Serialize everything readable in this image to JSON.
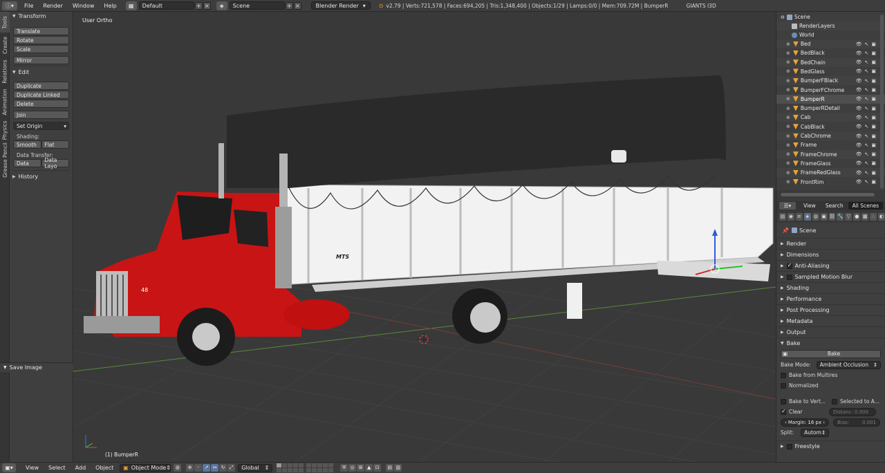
{
  "topbar": {
    "menus": [
      "File",
      "Render",
      "Window",
      "Help"
    ],
    "layout": "Default",
    "scene": "Scene",
    "engine": "Blender Render",
    "stats": "v2.79 | Verts:721,578 | Faces:694,205 | Tris:1,348,400 | Objects:1/29 | Lamps:0/0 | Mem:709.72M | BumperR",
    "extra": "GIANTS I3D"
  },
  "vtabs": [
    "Tools",
    "Create",
    "Relations",
    "Animation",
    "Physics",
    "Grease Pencil"
  ],
  "toolshelf": {
    "transform": {
      "title": "Transform",
      "buttons": [
        "Translate",
        "Rotate",
        "Scale",
        "Mirror"
      ]
    },
    "edit": {
      "title": "Edit",
      "buttons": [
        "Duplicate",
        "Duplicate Linked",
        "Delete",
        "Join"
      ],
      "set_origin": "Set Origin",
      "shading_label": "Shading:",
      "smooth": "Smooth",
      "flat": "Flat",
      "transfer_label": "Data Transfer:",
      "data": "Data",
      "data_layout": "Data Layo"
    },
    "history": "History",
    "save_image": "Save Image"
  },
  "viewport": {
    "view_label": "User Ortho",
    "object_label": "(1) BumperR",
    "truck_text": {
      "number": "48",
      "brand": "MTS"
    }
  },
  "outliner": {
    "scene": "Scene",
    "render_layers": "RenderLayers",
    "world": "World",
    "objects": [
      "Bed",
      "BedBlack",
      "BedChain",
      "BedGlass",
      "BumperFBlack",
      "BumperFChrome",
      "BumperR",
      "BumperRDetail",
      "Cab",
      "CabBlack",
      "CabChrome",
      "Frame",
      "FrameChrome",
      "FrameGlass",
      "FrameRedGlass",
      "FrontRim"
    ],
    "selected": "BumperR"
  },
  "outliner_header": {
    "view": "View",
    "search": "Search",
    "filter": "All Scenes"
  },
  "properties": {
    "context": "Scene",
    "sections": [
      "Render",
      "Dimensions",
      "Anti-Aliasing",
      "Sampled Motion Blur",
      "Shading",
      "Performance",
      "Post Processing",
      "Metadata",
      "Output",
      "Bake"
    ],
    "bake": {
      "button": "Bake",
      "mode_label": "Bake Mode:",
      "mode_value": "Ambient Occlusion",
      "from_multires": "Bake from Multires",
      "normalized": "Normalized",
      "to_vertex": "Bake to Vert...",
      "selected_to_active": "Selected to A...",
      "clear": "Clear",
      "distance": "Distanc: 0.000",
      "margin": "Margin: 16 px",
      "bias": "Bias:",
      "bias_value": "0.001",
      "split_label": "Split:",
      "split_value": "Autom"
    },
    "freestyle": "Freestyle"
  },
  "bottombar": {
    "menus": [
      "View",
      "Select",
      "Add",
      "Object"
    ],
    "mode": "Object Mode",
    "orientation": "Global"
  }
}
